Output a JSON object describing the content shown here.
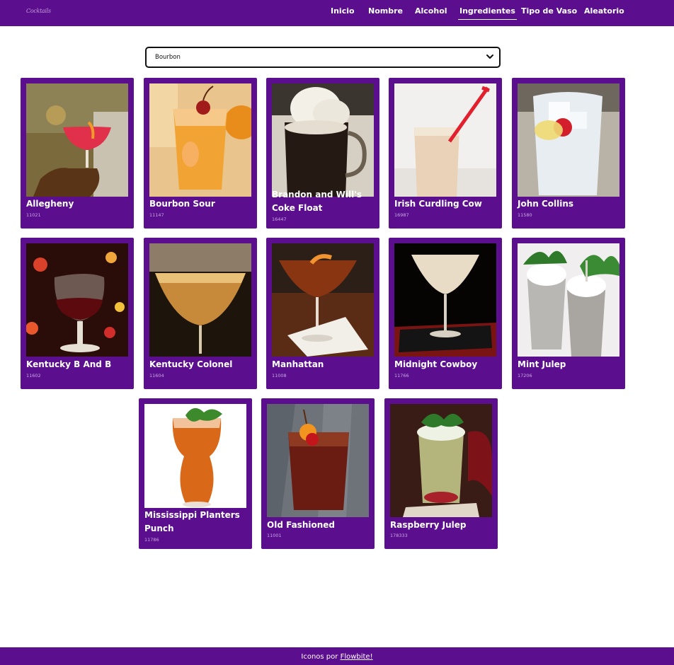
{
  "brand": {
    "logo_text": "Cocktails"
  },
  "nav": {
    "items": [
      {
        "label": "Inicio",
        "active": false
      },
      {
        "label": "Nombre",
        "active": false
      },
      {
        "label": "Alcohol",
        "active": false
      },
      {
        "label": "Ingredientes",
        "active": true
      },
      {
        "label": "Tipo de Vaso",
        "active": false
      },
      {
        "label": "Aleatorio",
        "active": false
      }
    ]
  },
  "filter": {
    "selected": "Bourbon"
  },
  "drinks": [
    {
      "name": "Allegheny",
      "id": "11021",
      "photo": "red coupe cocktail with orange twist, held in hand"
    },
    {
      "name": "Bourbon Sour",
      "id": "11147",
      "photo": "orange drink with cherry and orange slice"
    },
    {
      "name": "Brandon and Will's Coke Float",
      "id": "16447",
      "photo": "mug of dark coke with ice cream on top"
    },
    {
      "name": "Irish Curdling Cow",
      "id": "16987",
      "photo": "creamy drink with red straw"
    },
    {
      "name": "John Collins",
      "id": "11580",
      "photo": "clear glass with ice, lemon and cherry"
    },
    {
      "name": "Kentucky B And B",
      "id": "11602",
      "photo": "snifter of dark red liquid, bokeh lights"
    },
    {
      "name": "Kentucky Colonel",
      "id": "11604",
      "photo": "martini glass with amber drink"
    },
    {
      "name": "Manhattan",
      "id": "11008",
      "photo": "martini glass with orange peel on white napkin"
    },
    {
      "name": "Midnight Cowboy",
      "id": "11766",
      "photo": "creamy martini on black and red napkin"
    },
    {
      "name": "Mint Julep",
      "id": "17206",
      "photo": "two silver julep cups with mint"
    },
    {
      "name": "Mississippi Planters Punch",
      "id": "11786",
      "photo": "tall hurricane glass with mint garnish"
    },
    {
      "name": "Old Fashioned",
      "id": "11001",
      "photo": "rocks glass with orange and cherry on wood"
    },
    {
      "name": "Raspberry Julep",
      "id": "178333",
      "photo": "julep glass with mint and raspberries"
    }
  ],
  "footer": {
    "text": "Iconos por",
    "link": "Flowbite!"
  },
  "colors": {
    "brand_purple": "#5b0f8f",
    "background": "#ffffff",
    "id_text": "#c8a6e0"
  },
  "icons": {
    "select": "chevron-down-icon"
  }
}
